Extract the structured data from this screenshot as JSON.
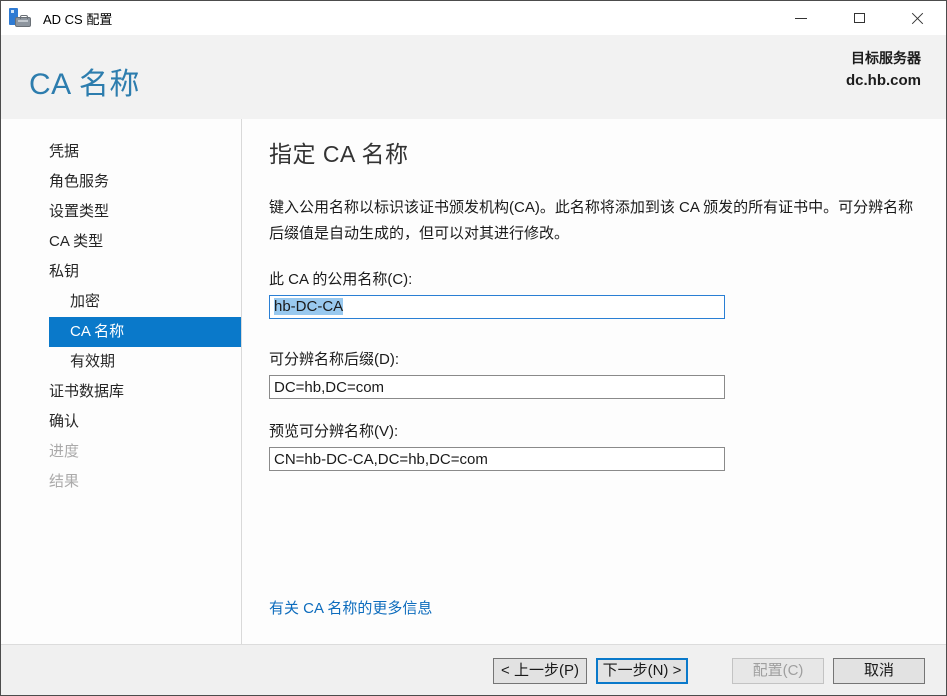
{
  "window": {
    "title": "AD CS 配置"
  },
  "header": {
    "title": "CA 名称",
    "target_server_label": "目标服务器",
    "target_server": "dc.hb.com"
  },
  "sidebar": {
    "items": [
      {
        "label": "凭据",
        "level": 0,
        "state": "normal"
      },
      {
        "label": "角色服务",
        "level": 0,
        "state": "normal"
      },
      {
        "label": "设置类型",
        "level": 0,
        "state": "normal"
      },
      {
        "label": "CA 类型",
        "level": 0,
        "state": "normal"
      },
      {
        "label": "私钥",
        "level": 0,
        "state": "normal"
      },
      {
        "label": "加密",
        "level": 1,
        "state": "normal"
      },
      {
        "label": "CA 名称",
        "level": 1,
        "state": "selected"
      },
      {
        "label": "有效期",
        "level": 1,
        "state": "normal"
      },
      {
        "label": "证书数据库",
        "level": 0,
        "state": "normal"
      },
      {
        "label": "确认",
        "level": 0,
        "state": "normal"
      },
      {
        "label": "进度",
        "level": 0,
        "state": "disabled"
      },
      {
        "label": "结果",
        "level": 0,
        "state": "disabled"
      }
    ]
  },
  "main": {
    "heading": "指定 CA 名称",
    "description": "键入公用名称以标识该证书颁发机构(CA)。此名称将添加到该 CA 颁发的所有证书中。可分辨名称后缀值是自动生成的，但可以对其进行修改。",
    "fields": [
      {
        "label": "此 CA 的公用名称(C):",
        "value": "hb-DC-CA",
        "focused": true,
        "text_selected": true
      },
      {
        "label": "可分辨名称后缀(D):",
        "value": "DC=hb,DC=com",
        "focused": false,
        "text_selected": false
      },
      {
        "label": "预览可分辨名称(V):",
        "value": "CN=hb-DC-CA,DC=hb,DC=com",
        "focused": false,
        "text_selected": false
      }
    ],
    "link": "有关 CA 名称的更多信息"
  },
  "footer": {
    "back_label": "< 上一步(P)",
    "next_label": "下一步(N) >",
    "configure_label": "配置(C)",
    "cancel_label": "取消",
    "configure_enabled": false
  },
  "colors": {
    "accent_blue": "#0a79ca",
    "header_title_blue": "#2d7dae",
    "selection_blue": "#99c9ef",
    "link_blue": "#0d6cbd",
    "disabled_text": "#abaaaa"
  }
}
